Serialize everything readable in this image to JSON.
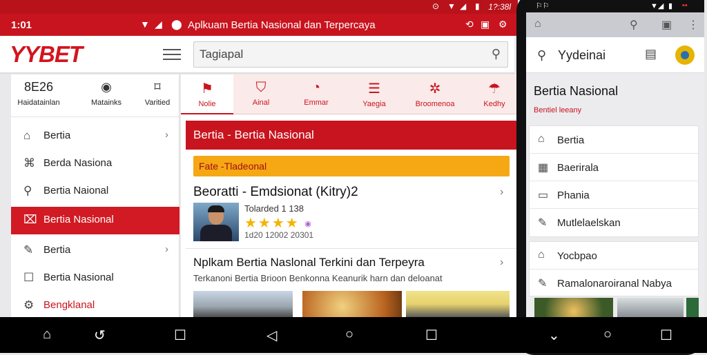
{
  "statusbar": {
    "time": "1?:38l"
  },
  "titlebar": {
    "number": "1:01",
    "title": "Aplkuam Bertia Nasional dan Terpercaya"
  },
  "header": {
    "logo": "YYBET",
    "search_value": "Tagiapal"
  },
  "sidebar": {
    "top": [
      {
        "glyph": "8E26",
        "label": "Haidatainlan",
        "icon": "counter-icon"
      },
      {
        "glyph": "◉",
        "label": "Matainks",
        "icon": "camera-icon"
      },
      {
        "glyph": "⌑",
        "label": "Varitied",
        "icon": "bookmark-icon"
      }
    ],
    "items": [
      {
        "label": "Bertia",
        "icon": "home-icon"
      },
      {
        "label": "Berda Nasiona",
        "icon": "institution-icon"
      },
      {
        "label": "Bertia Naional",
        "icon": "search-icon"
      },
      {
        "label": "Bertia Nasional",
        "icon": "document-icon"
      },
      {
        "label": "Bertia",
        "icon": "pen-icon"
      },
      {
        "label": "Bertia Nasional",
        "icon": "checkbox-icon"
      },
      {
        "label": "Bengklanal",
        "icon": "settings-icon"
      }
    ]
  },
  "tabs": [
    {
      "label": "Nolie",
      "icon": "flag-icon"
    },
    {
      "label": "Ainal",
      "icon": "shield-icon"
    },
    {
      "label": "Emmar",
      "icon": "alert-icon"
    },
    {
      "label": "Yaegia",
      "icon": "chart-icon"
    },
    {
      "label": "Broomenoa",
      "icon": "gear-icon"
    },
    {
      "label": "Kedhy",
      "icon": "cloud-icon"
    }
  ],
  "main": {
    "section_title": "Bertia - Bertia Nasional",
    "banner": "Fate -Tladeonal",
    "article1": {
      "title": "Beoratti - Emdsionat (Kitry)2",
      "meta": "Tolarded 1 138",
      "date": "1d20 12002 20301",
      "rating_stars": 4
    },
    "article2": {
      "title": "Nplkam Bertia Naslonal Terkini dan Terpeyra",
      "subtitle": "Terkanoni Bertia Brioon Benkonna Keanurik harn dan deloanat"
    }
  },
  "right": {
    "search_text": "Yydeinai",
    "title": "Bertia Nasional",
    "subtitle": "Bentiel leeany",
    "items": [
      {
        "label": "Bertia",
        "icon": "building-icon"
      },
      {
        "label": "Baerirala",
        "icon": "grid-icon"
      },
      {
        "label": "Phania",
        "icon": "box-icon"
      },
      {
        "label": "Mutlelaelskan",
        "icon": "edit-icon"
      }
    ],
    "items2": [
      {
        "label": "Yocbpao",
        "icon": "building-icon"
      },
      {
        "label": "Ramalonaroiranal Nabya",
        "icon": "edit-icon"
      }
    ]
  }
}
